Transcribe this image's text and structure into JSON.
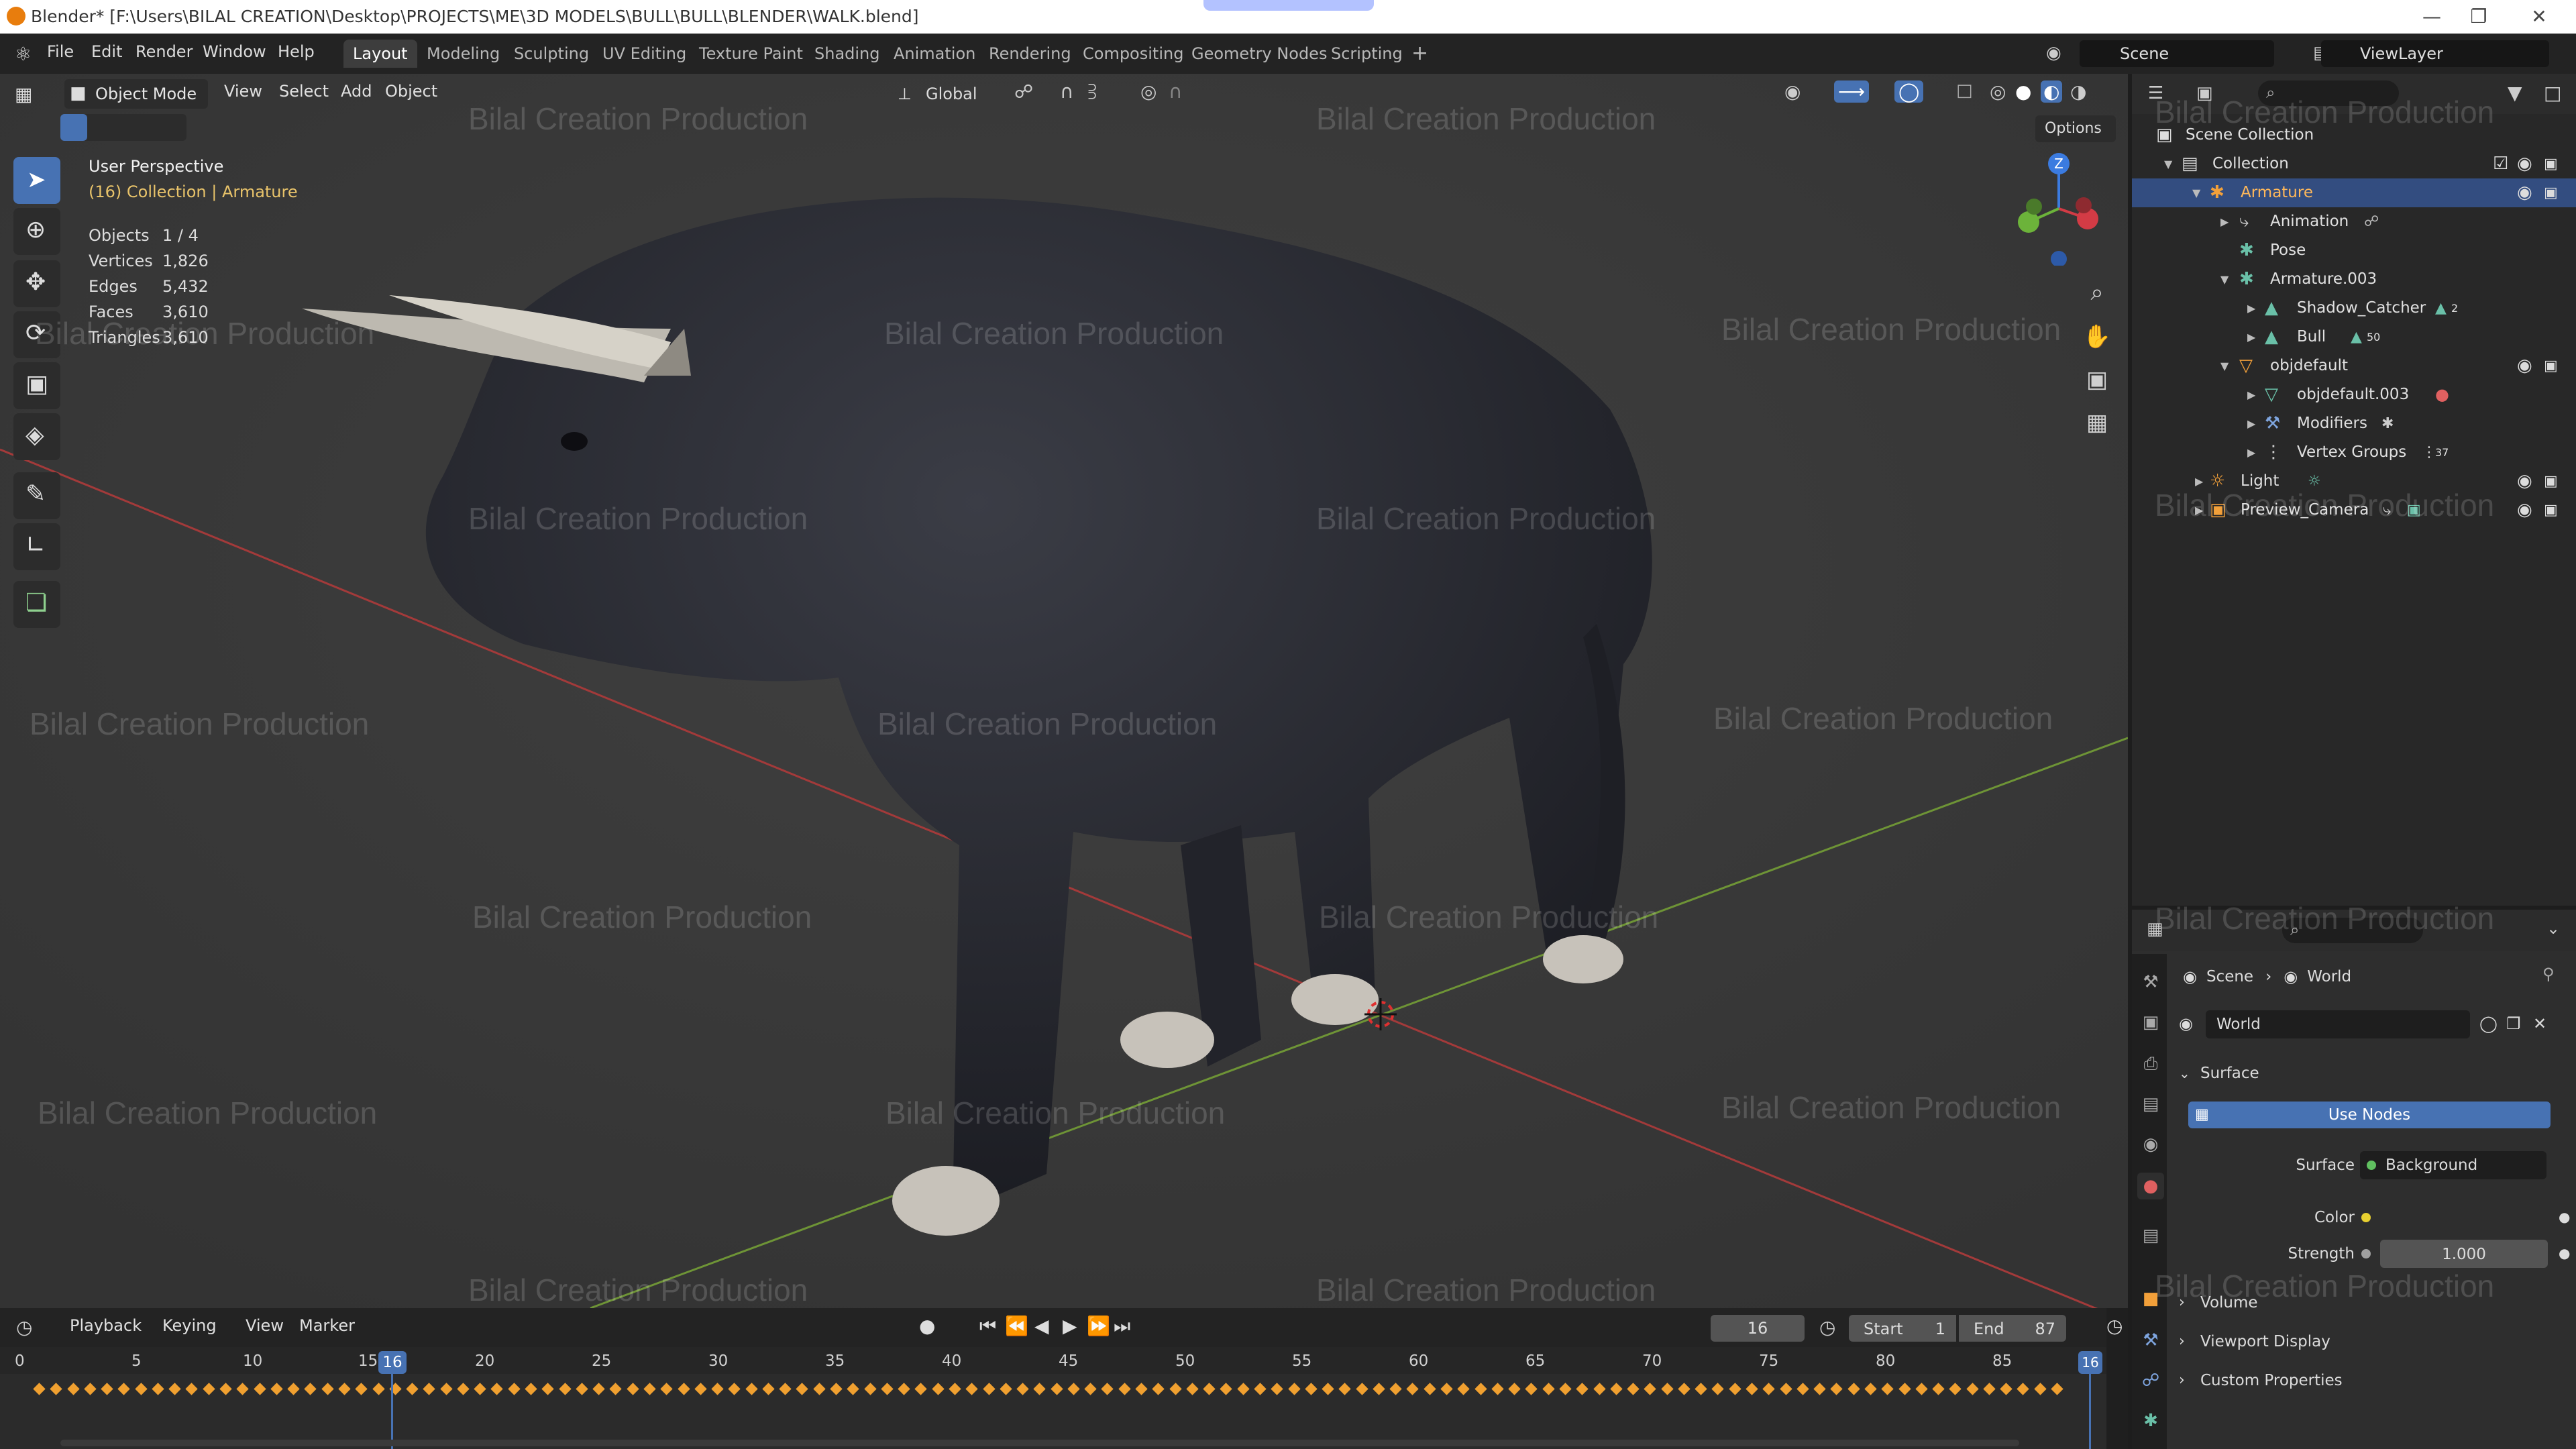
{
  "window": {
    "title": "Blender* [F:\\Users\\BILAL CREATION\\Desktop\\PROJECTS\\ME\\3D MODELS\\BULL\\BULL\\BLENDER\\WALK.blend]"
  },
  "menu": [
    "File",
    "Edit",
    "Render",
    "Window",
    "Help"
  ],
  "workspaces": [
    "Layout",
    "Modeling",
    "Sculpting",
    "UV Editing",
    "Texture Paint",
    "Shading",
    "Animation",
    "Rendering",
    "Compositing",
    "Geometry Nodes",
    "Scripting"
  ],
  "active_workspace": "Layout",
  "scene_field": "Scene",
  "viewlayer_field": "ViewLayer",
  "viewport": {
    "mode": "Object Mode",
    "menus": [
      "View",
      "Select",
      "Add",
      "Object"
    ],
    "transform_orientation": "Global",
    "options_label": "Options",
    "perspective_label": "User Perspective",
    "context_label": "(16) Collection | Armature",
    "stats": [
      {
        "label": "Objects",
        "value": "1 / 4"
      },
      {
        "label": "Vertices",
        "value": "1,826"
      },
      {
        "label": "Edges",
        "value": "5,432"
      },
      {
        "label": "Faces",
        "value": "3,610"
      },
      {
        "label": "Triangles",
        "value": "3,610"
      }
    ],
    "gizmo_axis_label": "Z",
    "watermark": "Bilal Creation Production"
  },
  "outliner": {
    "root": "Scene Collection",
    "rows": [
      {
        "label": "Collection",
        "depth": 1,
        "icon": "collection-icon"
      },
      {
        "label": "Armature",
        "depth": 2,
        "icon": "armature-icon",
        "selected": true
      },
      {
        "label": "Animation",
        "depth": 3,
        "icon": "action-icon"
      },
      {
        "label": "Pose",
        "depth": 3,
        "icon": "pose-icon"
      },
      {
        "label": "Armature.003",
        "depth": 3,
        "icon": "armature-data-icon"
      },
      {
        "label": "Shadow_Catcher",
        "depth": 4,
        "icon": "mesh-icon"
      },
      {
        "label": "Bull",
        "depth": 4,
        "icon": "mesh-icon"
      },
      {
        "label": "objdefault",
        "depth": 3,
        "icon": "mesh-object-icon"
      },
      {
        "label": "objdefault.003",
        "depth": 4,
        "icon": "mesh-data-icon"
      },
      {
        "label": "Modifiers",
        "depth": 4,
        "icon": "wrench-icon"
      },
      {
        "label": "Vertex Groups",
        "depth": 4,
        "icon": "vertex-groups-icon"
      },
      {
        "label": "Light",
        "depth": 2,
        "icon": "light-icon"
      },
      {
        "label": "Preview_Camera",
        "depth": 2,
        "icon": "camera-icon"
      }
    ],
    "badges": {
      "shadow_catcher": "2",
      "bull": "50",
      "vertex_groups": "37"
    }
  },
  "properties": {
    "breadcrumb": [
      "Scene",
      "World"
    ],
    "world_name": "World",
    "panels": {
      "surface": "Surface",
      "use_nodes": "Use Nodes",
      "surface_label": "Surface",
      "surface_value": "Background",
      "color_label": "Color",
      "strength_label": "Strength",
      "strength_value": "1.000",
      "volume": "Volume",
      "viewport_display": "Viewport Display",
      "custom_properties": "Custom Properties"
    }
  },
  "timeline": {
    "menus": [
      "Playback",
      "Keying",
      "View",
      "Marker"
    ],
    "current_frame": "16",
    "start_label": "Start",
    "start_value": "1",
    "end_label": "End",
    "end_value": "87",
    "ticks": [
      "0",
      "5",
      "10",
      "15",
      "20",
      "25",
      "30",
      "35",
      "40",
      "45",
      "50",
      "55",
      "60",
      "65",
      "70",
      "75",
      "80",
      "85"
    ],
    "playhead_label": "16",
    "end_marker_label": "16"
  },
  "colors": {
    "accent": "#4772b3",
    "selection": "#334d80",
    "keyframe": "#f0a030",
    "x_axis": "#c8413f",
    "y_axis": "#7ba43b",
    "viewport_bg": "#393939"
  }
}
